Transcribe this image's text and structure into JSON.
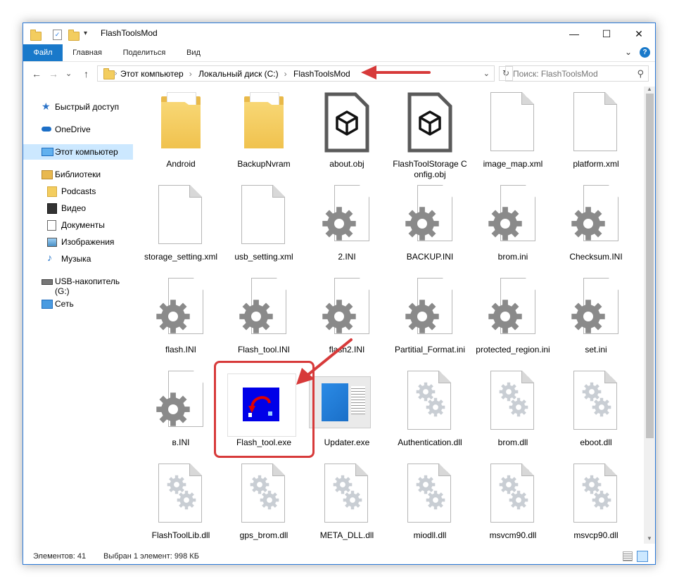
{
  "window": {
    "title": "FlashToolsMod",
    "buttons": {
      "minimize": "—",
      "maximize": "☐",
      "close": "✕"
    }
  },
  "ribbon": {
    "tabs": [
      "Файл",
      "Главная",
      "Поделиться",
      "Вид"
    ],
    "help": "?",
    "collapse": "⌄"
  },
  "nav_buttons": {
    "back": "←",
    "forward": "→",
    "recent": "⌄",
    "up": "↑"
  },
  "address": {
    "crumbs": [
      "Этот компьютер",
      "Локальный диск (C:)",
      "FlashToolsMod"
    ],
    "refresh": "↻"
  },
  "search": {
    "placeholder": "Поиск: FlashToolsMod",
    "icon": "search-icon"
  },
  "sidebar": {
    "items": [
      {
        "label": "Быстрый доступ",
        "icon": "star-icon"
      },
      {
        "label": "OneDrive",
        "icon": "cloud-icon"
      },
      {
        "label": "Этот компьютер",
        "icon": "computer-icon",
        "selected": true
      },
      {
        "label": "Библиотеки",
        "icon": "libraries-icon"
      },
      {
        "label": "Podcasts",
        "icon": "folder-icon"
      },
      {
        "label": "Видео",
        "icon": "video-icon"
      },
      {
        "label": "Документы",
        "icon": "documents-icon"
      },
      {
        "label": "Изображения",
        "icon": "pictures-icon"
      },
      {
        "label": "Музыка",
        "icon": "music-icon"
      },
      {
        "label": "USB-накопитель (G:)",
        "icon": "usb-drive-icon"
      },
      {
        "label": "Сеть",
        "icon": "network-icon"
      }
    ]
  },
  "files": [
    {
      "name": "Android",
      "type": "folder"
    },
    {
      "name": "BackupNvram",
      "type": "folder"
    },
    {
      "name": "about.obj",
      "type": "obj"
    },
    {
      "name": "FlashToolStorage Config.obj",
      "type": "obj"
    },
    {
      "name": "image_map.xml",
      "type": "doc"
    },
    {
      "name": "platform.xml",
      "type": "doc"
    },
    {
      "name": "storage_setting.xml",
      "type": "doc"
    },
    {
      "name": "usb_setting.xml",
      "type": "doc"
    },
    {
      "name": "2.INI",
      "type": "ini"
    },
    {
      "name": "BACKUP.INI",
      "type": "ini"
    },
    {
      "name": "brom.ini",
      "type": "ini"
    },
    {
      "name": "Checksum.INI",
      "type": "ini"
    },
    {
      "name": "flash.INI",
      "type": "ini"
    },
    {
      "name": "Flash_tool.INI",
      "type": "ini"
    },
    {
      "name": "flash2.INI",
      "type": "ini"
    },
    {
      "name": "Partitial_Format.ini",
      "type": "ini"
    },
    {
      "name": "protected_region.ini",
      "type": "ini"
    },
    {
      "name": "set.ini",
      "type": "ini"
    },
    {
      "name": "в.INI",
      "type": "ini"
    },
    {
      "name": "Flash_tool.exe",
      "type": "exe",
      "selected": true
    },
    {
      "name": "Updater.exe",
      "type": "updater"
    },
    {
      "name": "Authentication.dll",
      "type": "dll"
    },
    {
      "name": "brom.dll",
      "type": "dll"
    },
    {
      "name": "eboot.dll",
      "type": "dll"
    },
    {
      "name": "FlashToolLib.dll",
      "type": "dll"
    },
    {
      "name": "gps_brom.dll",
      "type": "dll"
    },
    {
      "name": "META_DLL.dll",
      "type": "dll"
    },
    {
      "name": "miodll.dll",
      "type": "dll"
    },
    {
      "name": "msvcm90.dll",
      "type": "dll"
    },
    {
      "name": "msvcp90.dll",
      "type": "dll"
    }
  ],
  "status": {
    "count": "Элементов: 41",
    "selection": "Выбран 1 элемент: 998 КБ"
  },
  "colors": {
    "accent": "#1979ca",
    "selection": "#cce8ff",
    "annotation": "#d73a3a"
  }
}
